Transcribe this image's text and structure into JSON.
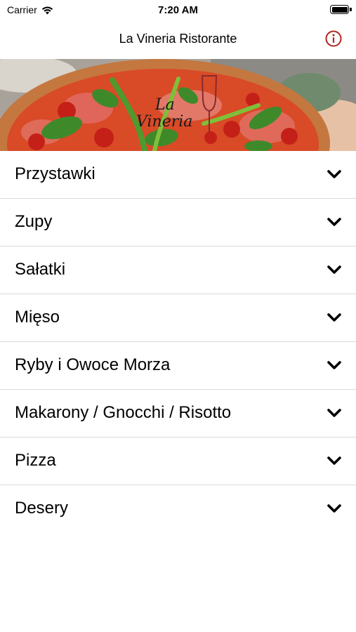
{
  "status_bar": {
    "carrier": "Carrier",
    "time": "7:20 AM",
    "battery_level": 1.0
  },
  "nav": {
    "title": "La Vineria Ristorante",
    "info_icon": "info-icon"
  },
  "banner": {
    "logo_text_1": "La",
    "logo_text_2": "Vineria"
  },
  "colors": {
    "accent": "#b3261e",
    "separator": "#d9d9d9"
  },
  "menu": {
    "items": [
      {
        "label": "Przystawki",
        "icon": "chevron-down-icon"
      },
      {
        "label": "Zupy",
        "icon": "chevron-down-icon"
      },
      {
        "label": "Sałatki",
        "icon": "chevron-down-icon"
      },
      {
        "label": "Mięso",
        "icon": "chevron-down-icon"
      },
      {
        "label": "Ryby i Owoce Morza",
        "icon": "chevron-down-icon"
      },
      {
        "label": "Makarony / Gnocchi / Risotto",
        "icon": "chevron-down-icon"
      },
      {
        "label": "Pizza",
        "icon": "chevron-down-icon"
      },
      {
        "label": "Desery",
        "icon": "chevron-down-icon"
      }
    ]
  }
}
